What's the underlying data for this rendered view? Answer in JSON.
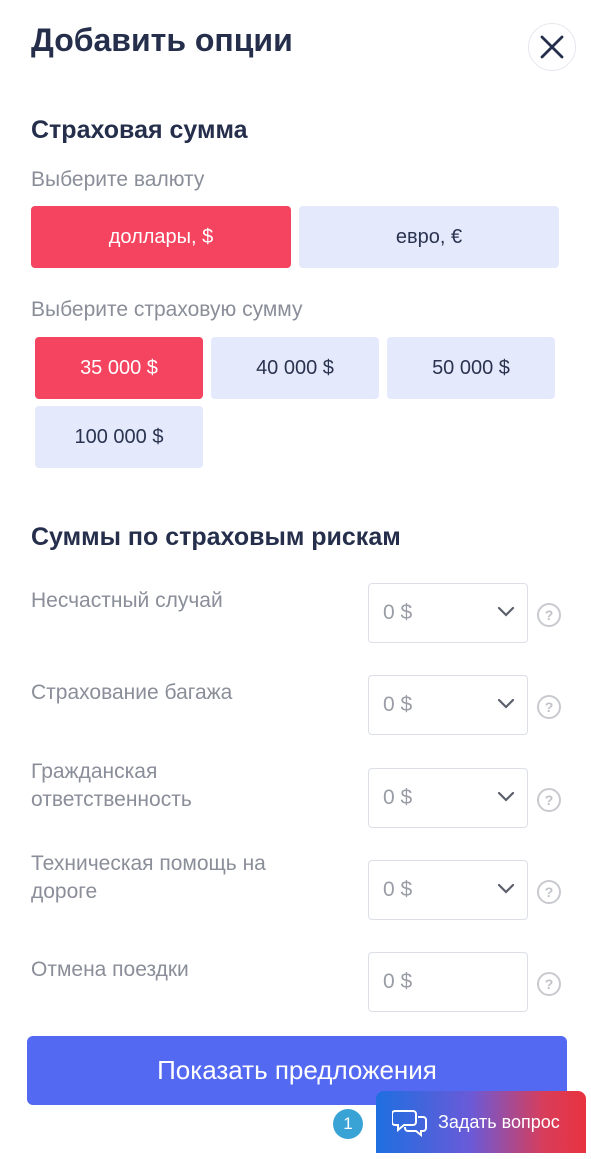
{
  "header": {
    "title": "Добавить опции"
  },
  "insured_sum": {
    "heading": "Страховая сумма",
    "currency_label": "Выберите валюту",
    "currencies": [
      "доллары, $",
      "евро, €"
    ],
    "selected_currency": "доллары, $",
    "amount_label": "Выберите страховую сумму",
    "amounts": [
      "35 000 $",
      "40 000 $",
      "50 000 $",
      "100 000 $"
    ],
    "selected_amount": "35 000 $"
  },
  "risks": {
    "heading": "Суммы по страховым рискам",
    "items": [
      {
        "label": "Несчастный случай",
        "value": "0 $",
        "dropdown": true
      },
      {
        "label": "Страхование багажа",
        "value": "0 $",
        "dropdown": true
      },
      {
        "label": "Гражданская ответственность",
        "value": "0 $",
        "dropdown": true
      },
      {
        "label": "Техническая помощь на дороге",
        "value": "0 $",
        "dropdown": true
      },
      {
        "label": "Отмена поездки",
        "value": "0 $",
        "dropdown": false
      }
    ],
    "help_glyph": "?"
  },
  "cta": {
    "label": "Показать предложения"
  },
  "chat": {
    "badge": "1",
    "label": "Задать вопрос"
  },
  "colors": {
    "accent": "#f4445f",
    "pill": "#e4e9fb",
    "primary": "#5469f2"
  }
}
